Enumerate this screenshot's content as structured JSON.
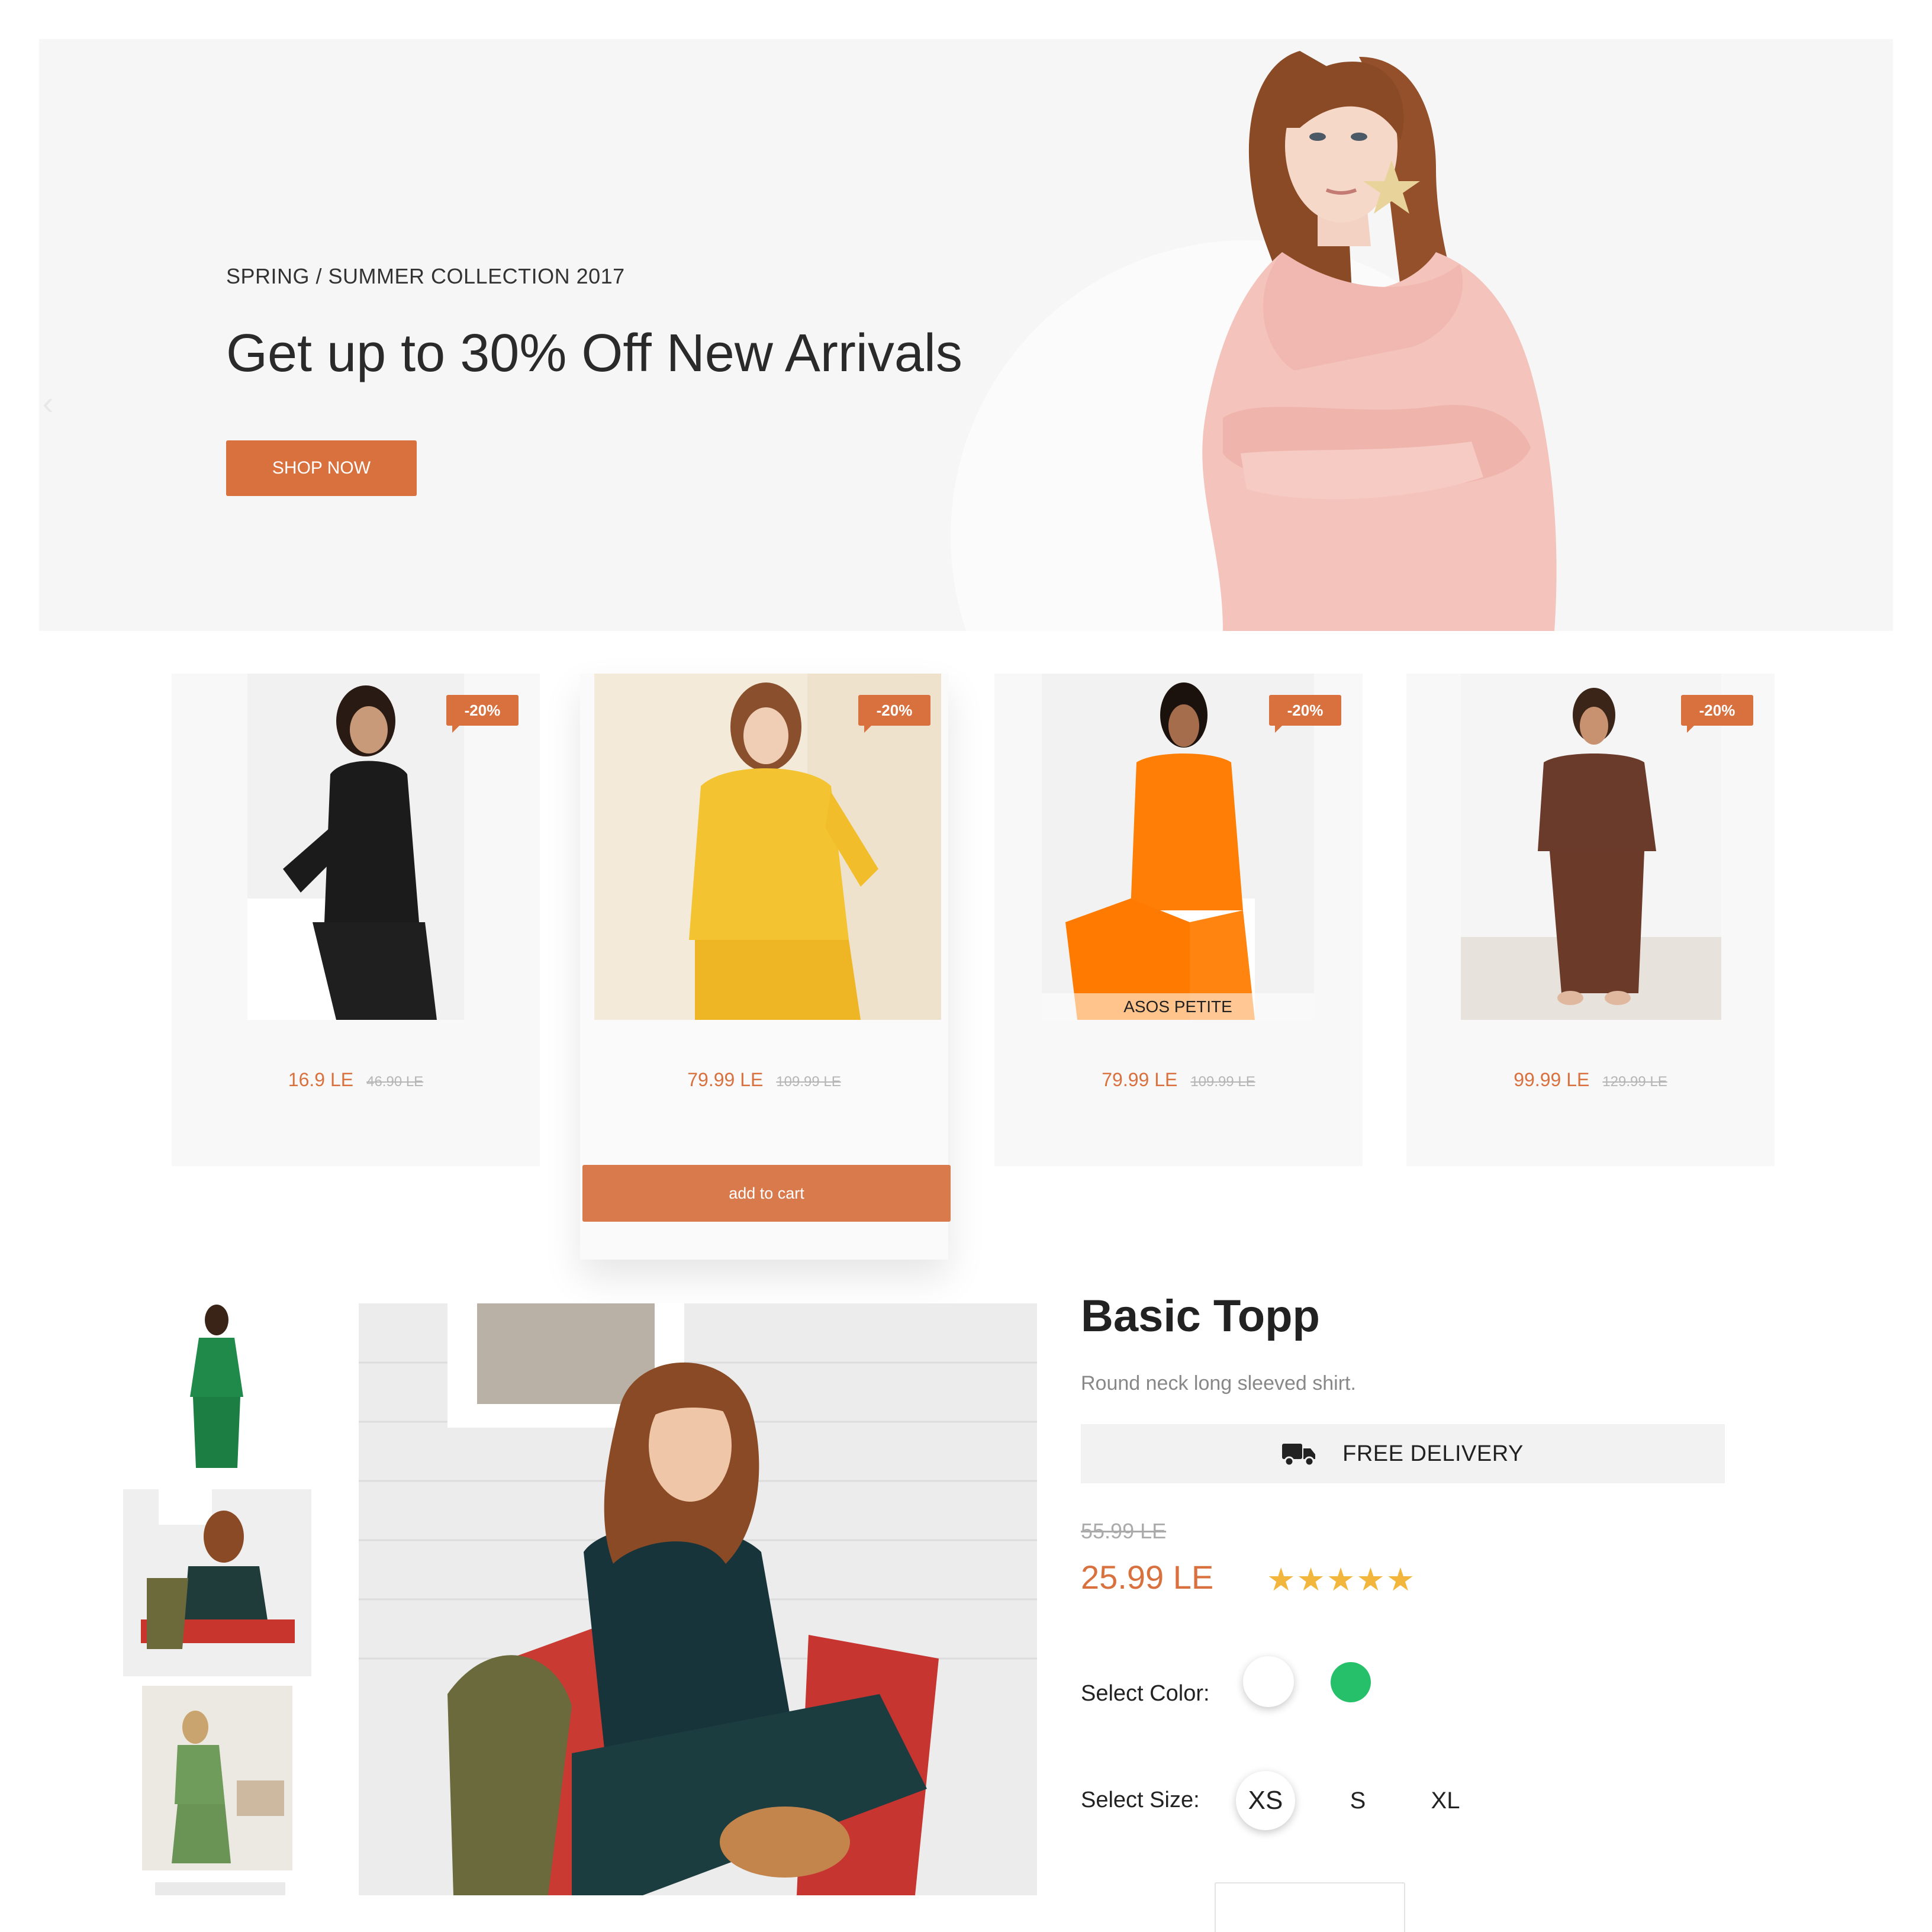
{
  "hero": {
    "eyebrow": "SPRING / SUMMER COLLECTION 2017",
    "title": "Get up to 30% Off New Arrivals",
    "cta": "SHOP NOW",
    "prev_icon": "‹"
  },
  "products": [
    {
      "badge": "-20%",
      "price": "16.9 LE",
      "old_price": "46.90 LE"
    },
    {
      "badge": "-20%",
      "price": "79.99 LE",
      "old_price": "109.99 LE",
      "cta": "add to cart"
    },
    {
      "badge": "-20%",
      "price": "79.99 LE",
      "old_price": "109.99 LE",
      "image_caption": "ASOS PETITE"
    },
    {
      "badge": "-20%",
      "price": "99.99 LE",
      "old_price": "129.99 LE"
    }
  ],
  "detail": {
    "title": "Basic Topp",
    "subtitle": "Round neck long sleeved shirt.",
    "delivery": "FREE DELIVERY",
    "delivery_icon": "truck-icon",
    "old_price": "55.99 LE",
    "price": "25.99 LE",
    "rating": 5,
    "color_label": "Select Color:",
    "colors": [
      "#ffffff",
      "#27c06a"
    ],
    "size_label": "Select Size:",
    "sizes": [
      "XS",
      "S",
      "XL"
    ],
    "selected_size": "XS"
  },
  "colors": {
    "accent": "#d9713f",
    "star": "#f2b63c"
  }
}
